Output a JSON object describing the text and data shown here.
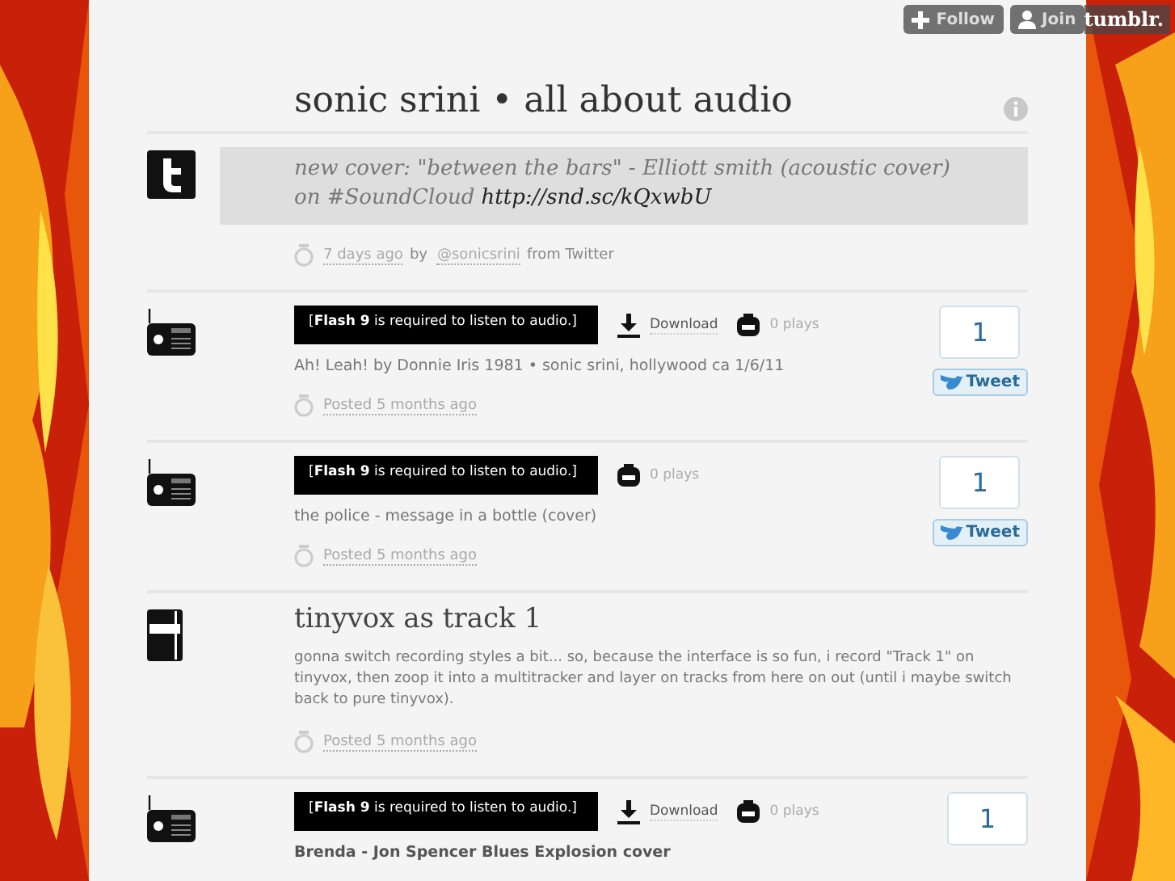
{
  "topbar": {
    "follow": "Follow",
    "join": "Join",
    "brand": "tumblr."
  },
  "blog": {
    "title": "sonic srini • all about audio"
  },
  "posts": [
    {
      "kind": "twitter",
      "quote": "new cover: \"between the bars\" - Elliott smith (acoustic cover) on #SoundCloud",
      "link": "http://snd.sc/kQxwbU",
      "meta": [
        {
          "text": "7 days ago",
          "kind": "link"
        },
        {
          "text": "by",
          "kind": "plain"
        },
        {
          "text": "@sonicsrini",
          "kind": "link"
        },
        {
          "text": "from Twitter",
          "kind": "plain"
        }
      ]
    },
    {
      "kind": "audio",
      "player": "[**Flash 9** is required to listen to audio.]",
      "download": "Download",
      "plays": "0 plays",
      "caption": "Ah! Leah! by Donnie Iris 1981 • sonic srini, hollywood ca 1/6/11",
      "meta": [
        {
          "text": "Posted 5 months ago",
          "kind": "link"
        }
      ],
      "tweet_count": "1",
      "tweet_label": "Tweet"
    },
    {
      "kind": "audio",
      "player": "[**Flash 9** is required to listen to audio.]",
      "plays": "0 plays",
      "caption": "the police - message in a bottle (cover)",
      "meta": [
        {
          "text": "Posted 5 months ago",
          "kind": "link"
        }
      ],
      "tweet_count": "1",
      "tweet_label": "Tweet"
    },
    {
      "kind": "text",
      "title": "tinyvox as track 1",
      "body": "gonna switch recording styles a bit... so, because the interface is so fun, i record \"Track 1\" on tinyvox, then zoop it into a multitracker and layer on tracks from here on out (until i maybe switch back to pure tinyvox).",
      "meta": [
        {
          "text": "Posted 5 months ago",
          "kind": "link"
        }
      ]
    },
    {
      "kind": "audio",
      "player": "[**Flash 9** is required to listen to audio.]",
      "download": "Download",
      "plays": "0 plays",
      "caption": "Brenda - Jon Spencer Blues Explosion cover",
      "tweet_count": "1"
    }
  ]
}
